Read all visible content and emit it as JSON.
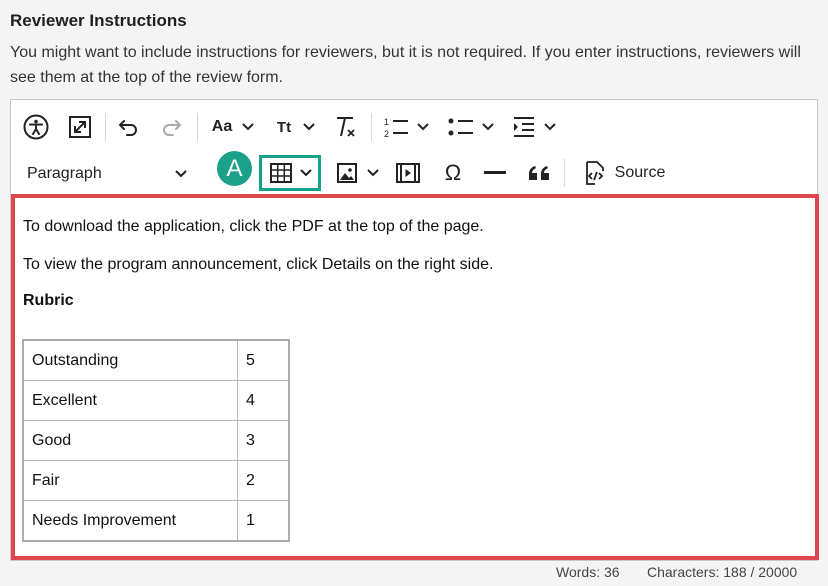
{
  "section": {
    "title": "Reviewer Instructions",
    "description": "You might want to include instructions for reviewers, but it is not required. If you enter instructions, reviewers will see them at the top of the review form."
  },
  "toolbar": {
    "row1": [
      "accessibility-icon",
      "fullscreen-icon",
      "undo-icon",
      "redo-icon",
      "font-family-icon",
      "font-size-icon",
      "remove-format-icon",
      "numbered-list-icon",
      "bulleted-list-icon",
      "indent-icon"
    ],
    "font_family_label": "Aa",
    "font_size_label": "Tt",
    "paragraph_label": "Paragraph",
    "source_label": "Source",
    "badge_label": "A"
  },
  "content": {
    "line1": "To download the application, click the PDF at the top of the page.",
    "line2": "To view the program announcement, click Details on the right side.",
    "heading": "Rubric",
    "table": [
      [
        "Outstanding",
        "5"
      ],
      [
        "Excellent",
        "4"
      ],
      [
        "Good",
        "3"
      ],
      [
        "Fair",
        "2"
      ],
      [
        "Needs Improvement",
        "1"
      ]
    ]
  },
  "status": {
    "words": "Words: 36",
    "characters": "Characters: 188 / 20000"
  },
  "colors": {
    "highlight_red": "#e04650",
    "highlight_teal": "#17a28a"
  }
}
